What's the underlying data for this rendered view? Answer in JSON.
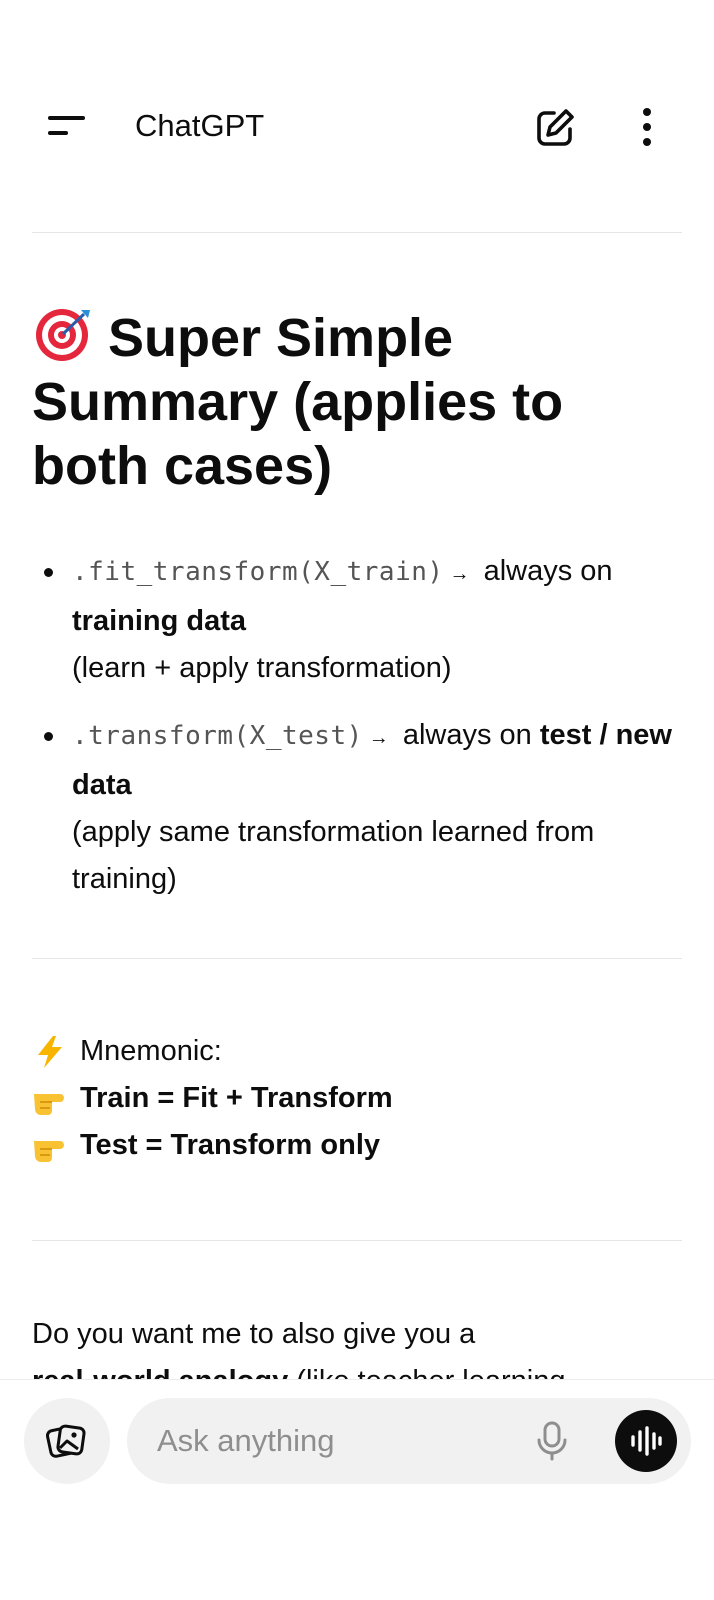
{
  "header": {
    "title": "ChatGPT",
    "menu_icon": "hamburger-menu-icon",
    "new_chat_icon": "edit-icon",
    "more_icon": "more-vertical-icon"
  },
  "message": {
    "heading_emoji": "🎯",
    "heading_text": "Super Simple Summary (applies to both cases)",
    "bullets": [
      {
        "code": ".fit_transform(X_train)",
        "arrow": "→",
        "text": " always on ",
        "bold": "training data",
        "note": "(learn + apply transformation)"
      },
      {
        "code": ".transform(X_test)",
        "arrow": "→",
        "text": " always on ",
        "bold": "test / new data",
        "note": "(apply same transformation learned from training)"
      }
    ],
    "mnemonic": {
      "label_emoji": "⚡",
      "label": "Mnemonic:",
      "pointer_emoji": "👉",
      "line1": "Train = Fit + Transform",
      "line2": "Test = Transform only"
    },
    "question": "Do you want me to also give you a",
    "question_bold": "real-world analogy",
    "question_rest": " (like teacher learning"
  },
  "composer": {
    "placeholder": "Ask anything",
    "attach_icon": "image-gallery-icon",
    "mic_icon": "microphone-icon",
    "voice_icon": "voice-mode-icon"
  },
  "colors": {
    "text": "#0d0d0d",
    "code": "#555555",
    "input_bg": "#f1f1f1",
    "voice_button_bg": "#0d0d0d"
  }
}
